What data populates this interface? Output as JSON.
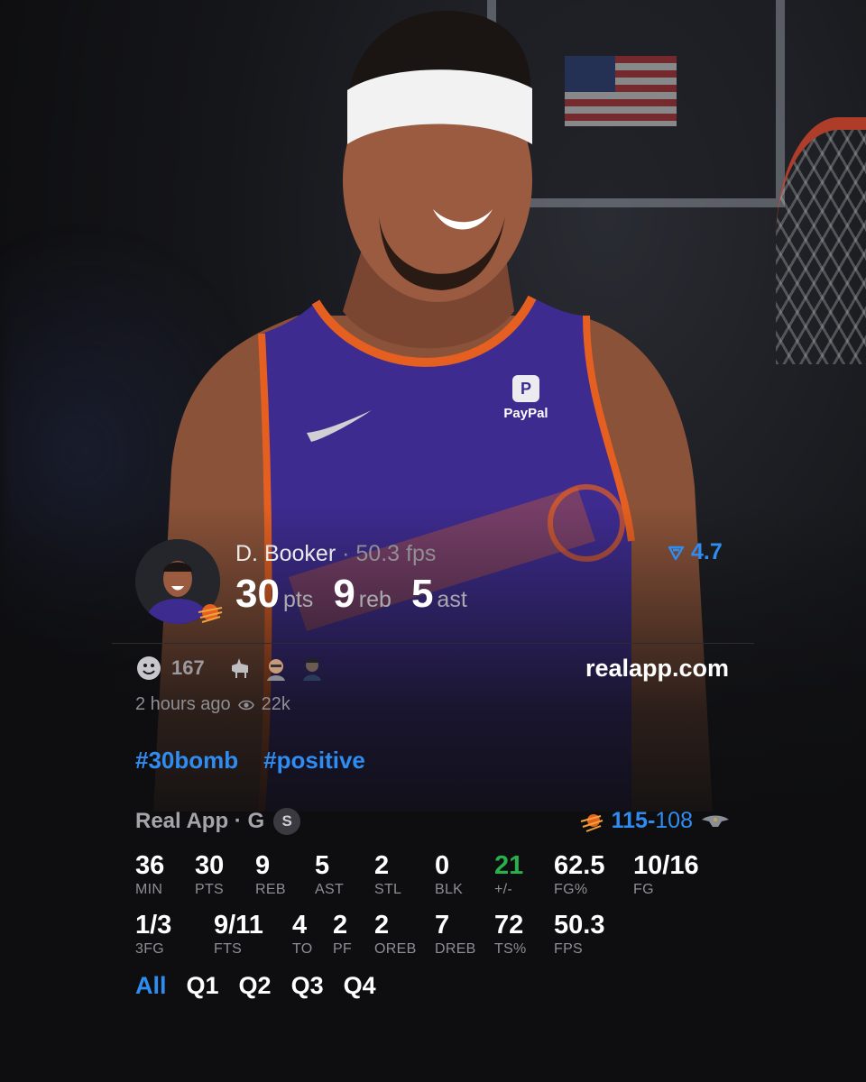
{
  "post": {
    "player_name": "D. Booker",
    "player_fps": "· 50.3 fps",
    "rating": "4.7",
    "headline": [
      {
        "value": "30",
        "unit": "pts"
      },
      {
        "value": "9",
        "unit": "reb"
      },
      {
        "value": "5",
        "unit": "ast"
      }
    ],
    "reaction_count": "167",
    "site": "realapp.com",
    "time_ago": "2 hours ago",
    "views": "22k",
    "tags": [
      "#30bomb",
      "#positive"
    ]
  },
  "game": {
    "source": "Real App · G",
    "source_badge": "S",
    "home_score": "115-",
    "away_score": "108"
  },
  "stats_row1": [
    {
      "value": "36",
      "label": "MIN"
    },
    {
      "value": "30",
      "label": "PTS"
    },
    {
      "value": "9",
      "label": "REB"
    },
    {
      "value": "5",
      "label": "AST"
    },
    {
      "value": "2",
      "label": "STL"
    },
    {
      "value": "0",
      "label": "BLK"
    },
    {
      "value": "21",
      "label": "+/-"
    },
    {
      "value": "62.5",
      "label": "FG%"
    },
    {
      "value": "10/16",
      "label": "FG"
    }
  ],
  "stats_row2": [
    {
      "value": "1/3",
      "label": "3FG"
    },
    {
      "value": "9/11",
      "label": "FTS"
    },
    {
      "value": "4",
      "label": "TO"
    },
    {
      "value": "2",
      "label": "PF"
    },
    {
      "value": "2",
      "label": "OREB"
    },
    {
      "value": "7",
      "label": "DREB"
    },
    {
      "value": "72",
      "label": "TS%"
    },
    {
      "value": "50.3",
      "label": "FPS"
    }
  ],
  "quarter_tabs": [
    "All",
    "Q1",
    "Q2",
    "Q3",
    "Q4"
  ],
  "jersey_text": "PayPal",
  "colors": {
    "accent": "#2f8cf0",
    "positive": "#28b04a",
    "suns_purple": "#3d2b8f",
    "suns_orange": "#e56020"
  },
  "icons": [
    "rating-arrow-icon",
    "smiley-icon",
    "goat-icon",
    "face-icon",
    "avatar-icon",
    "eye-icon",
    "suns-logo-icon",
    "pelicans-logo-icon"
  ]
}
